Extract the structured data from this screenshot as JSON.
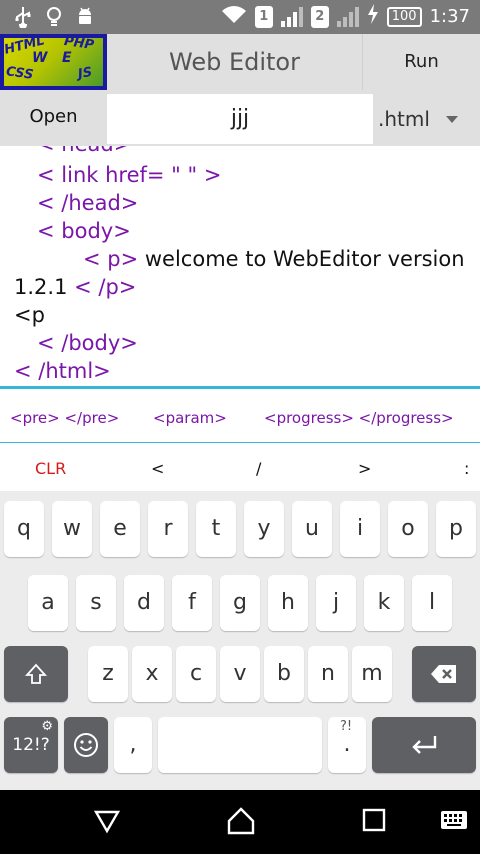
{
  "status_bar": {
    "left_icons": [
      "usb-icon",
      "lightbulb-icon",
      "android-icon"
    ],
    "sim1": "1",
    "sim2": "2",
    "battery": "100",
    "clock": "1:37"
  },
  "titlebar": {
    "logo_words": [
      "HTML",
      "PHP",
      "W",
      "E",
      "CSS",
      "JS"
    ],
    "title": "Web Editor",
    "run_label": "Run"
  },
  "filebar": {
    "open_label": "Open",
    "filename": "jjj",
    "extension": ".html"
  },
  "editor": {
    "lines": [
      {
        "tag": "< head>",
        "text": ""
      },
      {
        "tag": "< link href= \" \" >",
        "text": ""
      },
      {
        "tag": "< /head>",
        "text": ""
      },
      {
        "tag": "< body>",
        "text": ""
      },
      {
        "tag": "< p>",
        "text": " welcome to WebEditor version"
      },
      {
        "text": "1.2.1 ",
        "tag": "< /p>"
      },
      {
        "text": "<p",
        "tag": ""
      },
      {
        "tag": "< /body>",
        "text": ""
      },
      {
        "tag": "< /html>",
        "text": ""
      }
    ]
  },
  "snippets": [
    "<pre> </pre>",
    "<param>",
    "<progress> </progress>"
  ],
  "symbols": {
    "clr": "CLR",
    "lt": "<",
    "slash": "/",
    "gt": ">",
    "colon": ":"
  },
  "keyboard": {
    "row1": [
      "q",
      "w",
      "e",
      "r",
      "t",
      "y",
      "u",
      "i",
      "o",
      "p"
    ],
    "row2": [
      "a",
      "s",
      "d",
      "f",
      "g",
      "h",
      "j",
      "k",
      "l"
    ],
    "row3": [
      "z",
      "x",
      "c",
      "v",
      "b",
      "n",
      "m"
    ],
    "numeric_label": "12!?",
    "comma": ",",
    "period": ".",
    "period_hint": "?!"
  },
  "colors": {
    "tag": "#7b17a8",
    "accent": "#35b7d9",
    "clr": "#d31c1c"
  }
}
